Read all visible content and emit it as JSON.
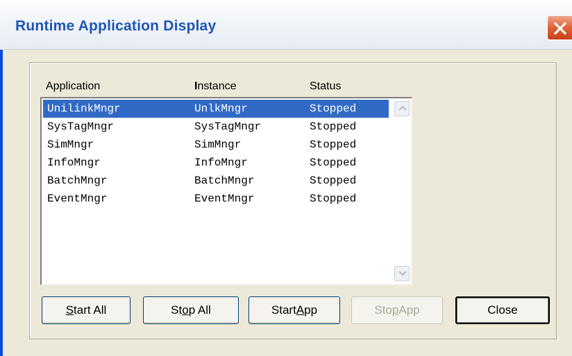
{
  "window": {
    "title": "Runtime Application Display",
    "close_icon": "close-icon",
    "accent_color": "#316ac5"
  },
  "list": {
    "columns": [
      "Application",
      "Instance",
      "Status"
    ],
    "rows": [
      {
        "application": "UnilinkMngr",
        "instance": "UnlkMngr",
        "status": "Stopped",
        "selected": true
      },
      {
        "application": "SysTagMngr",
        "instance": "SysTagMngr",
        "status": "Stopped",
        "selected": false
      },
      {
        "application": "SimMngr",
        "instance": "SimMngr",
        "status": "Stopped",
        "selected": false
      },
      {
        "application": "InfoMngr",
        "instance": "InfoMngr",
        "status": "Stopped",
        "selected": false
      },
      {
        "application": "BatchMngr",
        "instance": "BatchMngr",
        "status": "Stopped",
        "selected": false
      },
      {
        "application": "EventMngr",
        "instance": "EventMngr",
        "status": "Stopped",
        "selected": false
      }
    ]
  },
  "buttons": {
    "start_all": {
      "label": "Start All",
      "mnemonic": "S"
    },
    "stop_all": {
      "label": "Stop All",
      "mnemonic": "o"
    },
    "start_app": {
      "label": "Start App",
      "mnemonic": "A"
    },
    "stop_app": {
      "label": "Stop App",
      "mnemonic": "p",
      "enabled": false
    },
    "close": {
      "label": "Close"
    }
  }
}
